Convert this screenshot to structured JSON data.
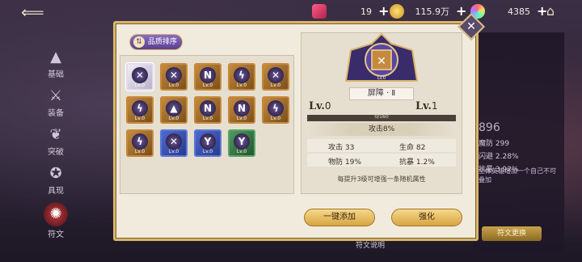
{
  "currency": {
    "gem": {
      "value": "19"
    },
    "gold": {
      "value": "115.9万"
    },
    "orb": {
      "value": "4385"
    }
  },
  "nav": {
    "items": [
      {
        "label": "基础"
      },
      {
        "label": "装备"
      },
      {
        "label": "突破"
      },
      {
        "label": "具现"
      },
      {
        "label": "符文"
      }
    ]
  },
  "sort_button": {
    "label": "品质排序"
  },
  "runes": [
    {
      "quality": "white",
      "lv": "Lv.0",
      "glyph": "✕"
    },
    {
      "quality": "gold",
      "lv": "Lv.0",
      "glyph": "✕"
    },
    {
      "quality": "gold",
      "lv": "Lv.0",
      "glyph": "N"
    },
    {
      "quality": "gold",
      "lv": "Lv.0",
      "glyph": "ϟ"
    },
    {
      "quality": "gold",
      "lv": "Lv.0",
      "glyph": "✕"
    },
    {
      "quality": "gold",
      "lv": "Lv.0",
      "glyph": "ϟ"
    },
    {
      "quality": "gold",
      "lv": "Lv.0",
      "glyph": "▲"
    },
    {
      "quality": "gold",
      "lv": "Lv.0",
      "glyph": "N"
    },
    {
      "quality": "gold",
      "lv": "Lv.0",
      "glyph": "N"
    },
    {
      "quality": "gold",
      "lv": "Lv.0",
      "glyph": "ϟ"
    },
    {
      "quality": "gold",
      "lv": "Lv.0",
      "glyph": "ϟ"
    },
    {
      "quality": "blue",
      "lv": "Lv.0",
      "glyph": "✕"
    },
    {
      "quality": "blue",
      "lv": "Lv.0",
      "glyph": "Y"
    },
    {
      "quality": "green",
      "lv": "Lv.0",
      "glyph": "Y"
    }
  ],
  "detail": {
    "name": "屏障 · Ⅱ",
    "crest_lv": "Lv.0",
    "lv_label": "Lv.",
    "current_lv": "0",
    "next_lv": "1",
    "progress": "0/160",
    "progress_fraction": 0,
    "main_attr": "攻击8%",
    "stats": [
      {
        "label": "攻击",
        "value": "33"
      },
      {
        "label": "生命",
        "value": "82"
      },
      {
        "label": "物防",
        "value": "19%"
      },
      {
        "label": "抗暴",
        "value": "1.2%"
      }
    ],
    "tip": "每提升3级可增强一条随机属性"
  },
  "buttons": {
    "quick_add": "一键添加",
    "enhance": "强化"
  },
  "background_panel": {
    "power": "896",
    "stats": [
      {
        "label": "魔防",
        "value": "299"
      },
      {
        "label": "闪避",
        "value": "2.28%"
      },
      {
        "label": "抗暴",
        "value": "3.92%"
      }
    ],
    "note": "全体英雄增加一个自己不可叠加",
    "button": "符文更换",
    "tab": "符文说明"
  },
  "colors": {
    "dialog_bg": "#f1ebde",
    "gold_border": "#d8b56a",
    "button_gold": "#d7a443"
  }
}
